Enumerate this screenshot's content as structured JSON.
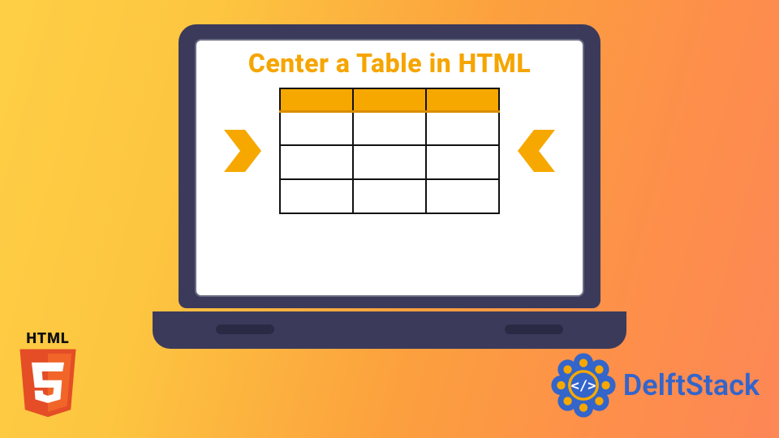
{
  "title": "Center a Table in HTML",
  "html5_label": "HTML",
  "brand_name": "DelftStack",
  "colors": {
    "accent": "#f5a500",
    "bezel": "#3b3a5b",
    "brand_blue": "#3365cb"
  },
  "chart_data": {
    "type": "table",
    "columns": 3,
    "rows": 3,
    "header_values": [
      "",
      "",
      ""
    ],
    "cells": [
      [
        "",
        "",
        ""
      ],
      [
        "",
        "",
        ""
      ],
      [
        "",
        "",
        ""
      ]
    ]
  }
}
